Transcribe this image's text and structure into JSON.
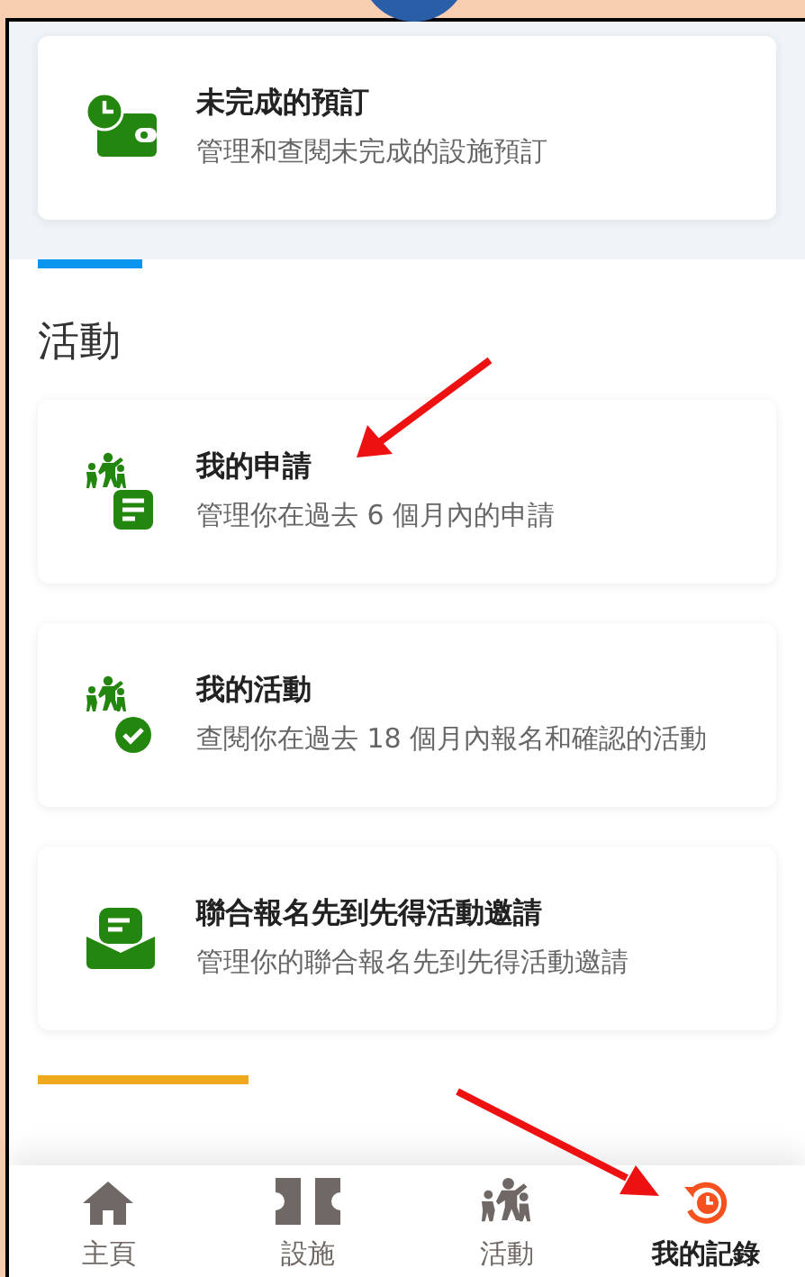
{
  "top_cards": [
    {
      "title": "未完成的預訂",
      "subtitle": "管理和查閱未完成的設施預訂"
    }
  ],
  "section": {
    "heading": "活動",
    "cards": [
      {
        "title": "我的申請",
        "subtitle": "管理你在過去 6 個月內的申請"
      },
      {
        "title": "我的活動",
        "subtitle": "查閱你在過去 18 個月內報名和確認的活動"
      },
      {
        "title": "聯合報名先到先得活動邀請",
        "subtitle": "管理你的聯合報名先到先得活動邀請"
      }
    ]
  },
  "nav": [
    {
      "label": "主頁",
      "selected": false
    },
    {
      "label": "設施",
      "selected": false
    },
    {
      "label": "活動",
      "selected": false
    },
    {
      "label": "我的記錄",
      "selected": true
    }
  ]
}
